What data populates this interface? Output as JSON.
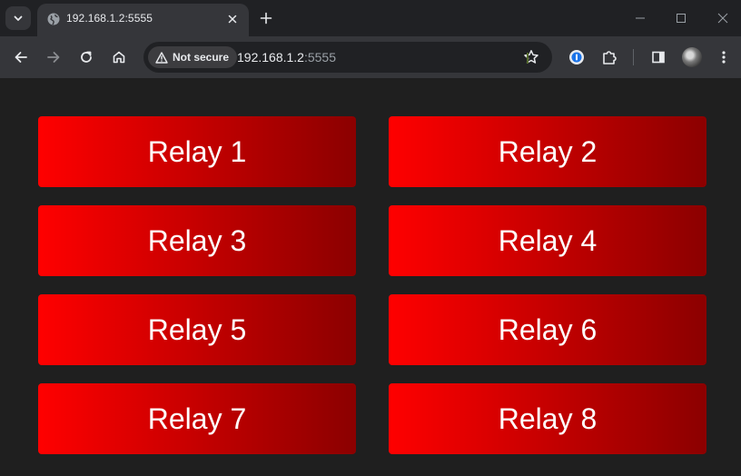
{
  "browser": {
    "tab": {
      "title": "192.168.1.2:5555",
      "favicon": "globe-icon"
    },
    "omnibox": {
      "security_label": "Not secure",
      "url_host": "192.168.1.2",
      "url_port": ":5555"
    },
    "icons": {
      "tab_search": "chevron-down-icon",
      "close_tab": "close-icon",
      "new_tab": "plus-icon",
      "minimize": "minimize-icon",
      "maximize": "maximize-icon",
      "close_window": "close-icon",
      "back": "arrow-left-icon",
      "forward": "arrow-right-icon",
      "reload": "reload-icon",
      "home": "home-icon",
      "warning": "warning-icon",
      "bookmark": "star-icon",
      "password_manager": "password-manager-icon",
      "extensions": "puzzle-icon",
      "side_panel": "side-panel-icon",
      "profile": "avatar",
      "menu": "kebab-menu-icon"
    }
  },
  "page": {
    "background": "#1f1f1f",
    "relays": [
      {
        "label": "Relay 1"
      },
      {
        "label": "Relay 2"
      },
      {
        "label": "Relay 3"
      },
      {
        "label": "Relay 4"
      },
      {
        "label": "Relay 5"
      },
      {
        "label": "Relay 6"
      },
      {
        "label": "Relay 7"
      },
      {
        "label": "Relay 8"
      }
    ],
    "colors": {
      "button_gradient_start": "#ff0000",
      "button_gradient_end": "#8b0000",
      "button_text": "#ffffff"
    }
  }
}
